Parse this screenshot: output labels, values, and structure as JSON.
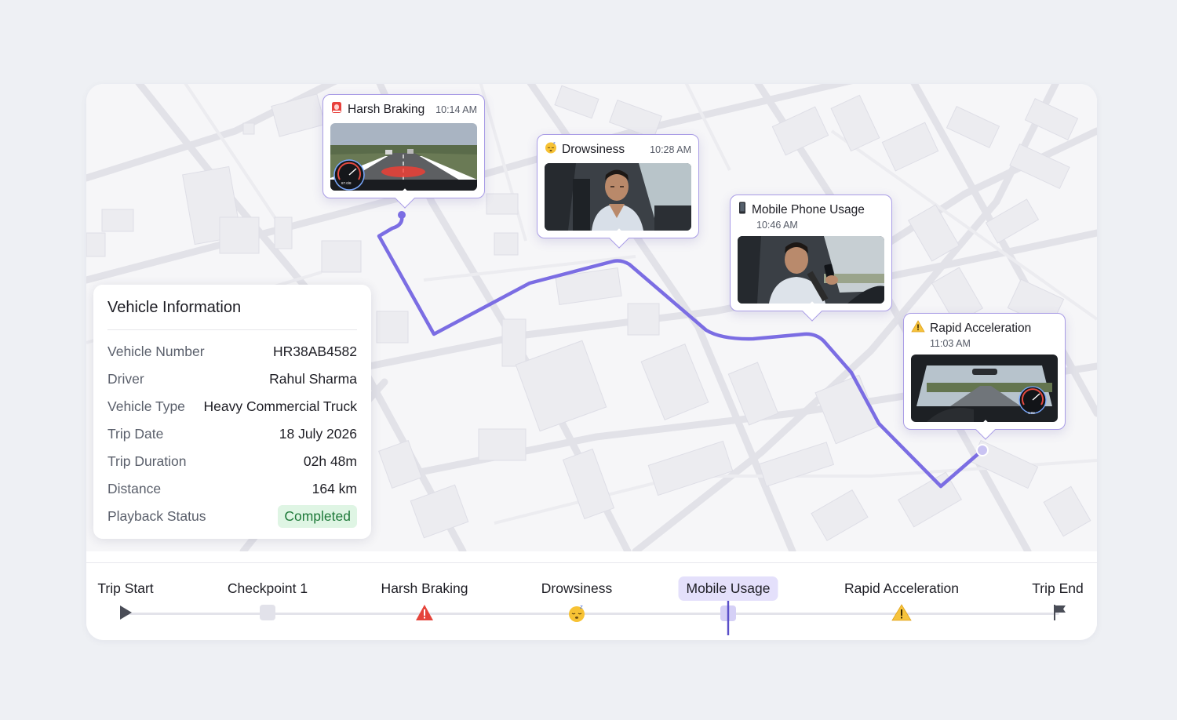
{
  "colors": {
    "route": "#7b6de3",
    "accent_bg": "#e4e0fb",
    "status_bg": "#dff5e4",
    "status_text": "#1f7a3a"
  },
  "events": [
    {
      "title": "Harsh Braking",
      "time": "10:14 AM",
      "icon": "siren-icon",
      "thumb": "dashcam-road-braking"
    },
    {
      "title": "Drowsiness",
      "time": "10:28 AM",
      "icon": "sleepy-face-icon",
      "thumb": "driver-drowsy"
    },
    {
      "title": "Mobile Phone Usage",
      "time": "10:46 AM",
      "icon": "phone-icon",
      "thumb": "driver-phone"
    },
    {
      "title": "Rapid Acceleration",
      "time": "11:03 AM",
      "icon": "warning-icon",
      "thumb": "dashcam-road-acceleration"
    }
  ],
  "vehicle": {
    "title": "Vehicle Information",
    "rows": [
      {
        "label": "Vehicle Number",
        "value": "HR38AB4582"
      },
      {
        "label": "Driver",
        "value": "Rahul Sharma"
      },
      {
        "label": "Vehicle Type",
        "value": "Heavy Commercial Truck"
      },
      {
        "label": "Trip Date",
        "value": "18 July 2026"
      },
      {
        "label": "Trip Duration",
        "value": "02h 48m"
      },
      {
        "label": "Distance",
        "value": "164 km"
      },
      {
        "label": "Playback Status",
        "value": "Completed"
      }
    ]
  },
  "timeline": [
    {
      "label": "Trip Start",
      "icon": "play-icon"
    },
    {
      "label": "Checkpoint 1",
      "icon": "checkpoint-icon"
    },
    {
      "label": "Harsh Braking",
      "icon": "warning-red-icon"
    },
    {
      "label": "Drowsiness",
      "icon": "sleepy-face-icon"
    },
    {
      "label": "Mobile Usage",
      "icon": "playhead-icon",
      "active": true
    },
    {
      "label": "Rapid Acceleration",
      "icon": "warning-icon"
    },
    {
      "label": "Trip End",
      "icon": "flag-icon"
    }
  ],
  "speedometer_text": {
    "braking": "87.0/8",
    "acceleration": "1:09"
  }
}
